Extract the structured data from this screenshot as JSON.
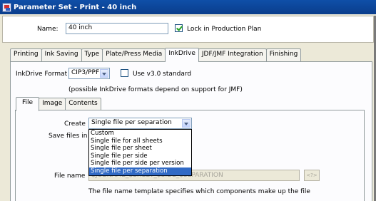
{
  "window": {
    "title": "Parameter Set - Print - 40 inch"
  },
  "header": {
    "name_label": "Name:",
    "name_value": "40 inch",
    "lock_label": "Lock in Production Plan",
    "lock_checked": true
  },
  "tabs": [
    {
      "label": "Printing",
      "active": false
    },
    {
      "label": "Ink Saving",
      "active": false
    },
    {
      "label": "Type",
      "active": false
    },
    {
      "label": "Plate/Press Media",
      "active": false
    },
    {
      "label": "InkDrive",
      "active": true
    },
    {
      "label": "JDF/JMF Integration",
      "active": false
    },
    {
      "label": "Finishing",
      "active": false
    }
  ],
  "inkdrive": {
    "format_label": "InkDrive Format",
    "format_value": "CIP3/PPF",
    "v3_label": "Use v3.0 standard",
    "v3_checked": false,
    "note": "(possible InkDrive formats depend on support for JMF)"
  },
  "subtabs": [
    {
      "label": "File",
      "active": true
    },
    {
      "label": "Image",
      "active": false
    },
    {
      "label": "Contents",
      "active": false
    }
  ],
  "file": {
    "create_label": "Create",
    "create_value": "Single file per separation",
    "save_label": "Save files in",
    "options": [
      "Custom",
      "Single file for all sheets",
      "Single file per sheet",
      "Single file per side",
      "Single file per side per version",
      "Single file per separation"
    ],
    "selected_index": 5,
    "filename_label": "File name",
    "filename_value": "$JOBNAME_$SHEET_$SIDE_$SEPARATION",
    "insert_label": "<?>",
    "help_text": "The file name template specifies which components make up the file"
  }
}
